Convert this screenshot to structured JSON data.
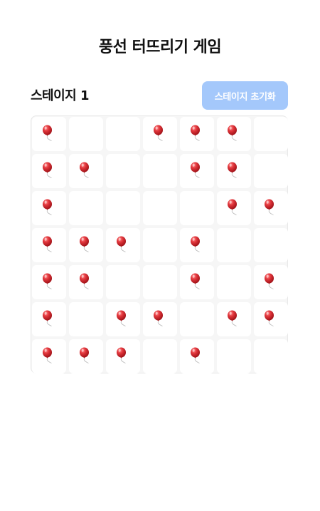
{
  "header": {
    "title": "풍선 터뜨리기 게임"
  },
  "stage": {
    "label": "스테이지 1",
    "reset_label": "스테이지 초기화"
  },
  "board": {
    "rows": 7,
    "cols": 7,
    "cells": [
      [
        1,
        0,
        0,
        1,
        1,
        1,
        0
      ],
      [
        1,
        1,
        0,
        0,
        1,
        1,
        0
      ],
      [
        1,
        0,
        0,
        0,
        0,
        1,
        1
      ],
      [
        1,
        1,
        1,
        0,
        1,
        0,
        0
      ],
      [
        1,
        1,
        0,
        0,
        1,
        0,
        1
      ],
      [
        1,
        0,
        1,
        1,
        0,
        1,
        1
      ],
      [
        1,
        1,
        1,
        0,
        1,
        0,
        0
      ]
    ],
    "balloon_color": "#e0343a",
    "icon": "balloon-icon"
  }
}
